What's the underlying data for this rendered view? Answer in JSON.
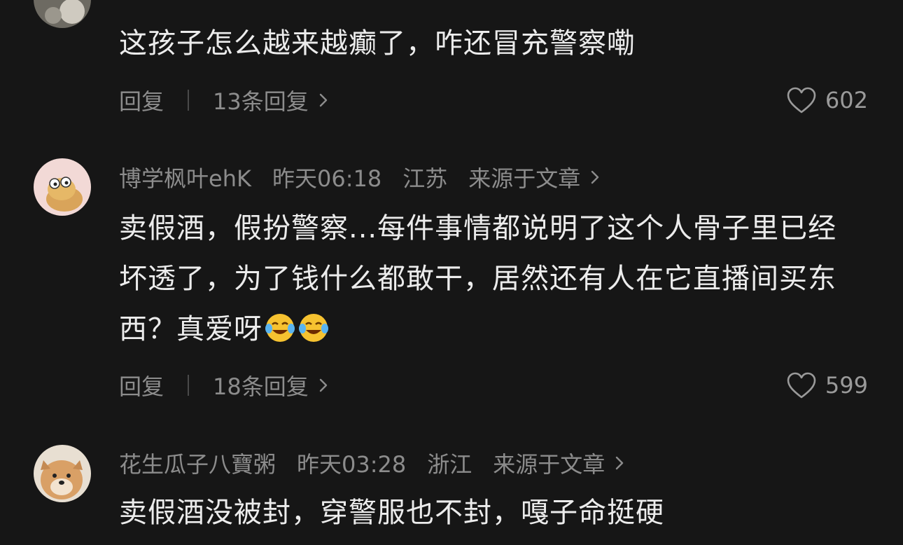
{
  "comments": [
    {
      "text": "这孩子怎么越来越癫了，咋还冒充警察嘞",
      "reply_label": "回复",
      "replies_label": "13条回复",
      "likes": "602"
    },
    {
      "author": "博学枫叶ehK",
      "time": "昨天06:18",
      "location": "江苏",
      "source": "来源于文章",
      "text": "卖假酒，假扮警察...每件事情都说明了这个人骨子里已经坏透了，为了钱什么都敢干，居然还有人在它直播间买东西？真爱呀",
      "emojis": [
        "tears-of-joy-icon",
        "tears-of-joy-icon"
      ],
      "reply_label": "回复",
      "replies_label": "18条回复",
      "likes": "599"
    },
    {
      "author": "花生瓜子八寶粥",
      "time": "昨天03:28",
      "location": "浙江",
      "source": "来源于文章",
      "text": "卖假酒没被封，穿警服也不封，嘎子命挺硬"
    }
  ],
  "colors": {
    "background": "#161616",
    "text": "#ececec",
    "muted": "#8c8c8c"
  }
}
